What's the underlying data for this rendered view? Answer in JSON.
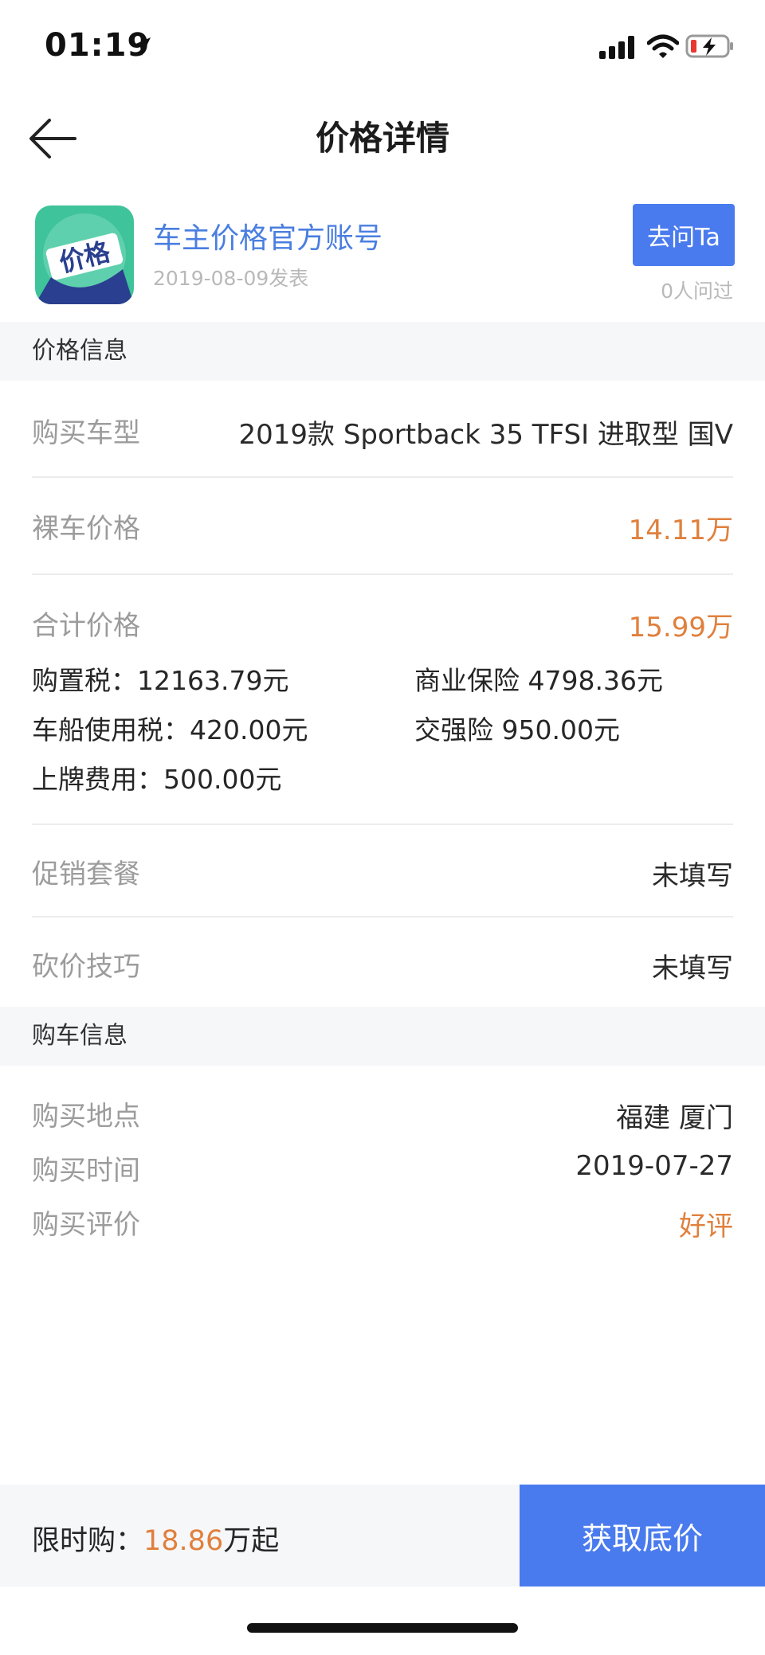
{
  "status_bar": {
    "time": "01:19"
  },
  "nav": {
    "title": "价格详情"
  },
  "author": {
    "avatar_text": "价格",
    "name": "车主价格官方账号",
    "date": "2019-08-09发表",
    "ask_label": "去问Ta",
    "ask_count": "0人问过"
  },
  "price_section": {
    "header": "价格信息",
    "model": {
      "label": "购买车型",
      "value": "2019款 Sportback 35 TFSI 进取型 国V"
    },
    "bare": {
      "label": "裸车价格",
      "value": "14.11万"
    },
    "total": {
      "label": "合计价格",
      "value": "15.99万"
    },
    "fees": {
      "purchase_tax": "购置税：12163.79元",
      "commercial_insurance": "商业保险 4798.36元",
      "vehicle_tax": "车船使用税：420.00元",
      "compulsory_insurance": "交强险 950.00元",
      "plate_fee": "上牌费用：500.00元"
    },
    "promo": {
      "label": "促销套餐",
      "value": "未填写"
    },
    "bargain": {
      "label": "砍价技巧",
      "value": "未填写"
    }
  },
  "purchase_section": {
    "header": "购车信息",
    "place": {
      "label": "购买地点",
      "value": "福建 厦门"
    },
    "time": {
      "label": "购买时间",
      "value": "2019-07-27"
    },
    "review": {
      "label": "购买评价",
      "value": "好评"
    }
  },
  "bottom_bar": {
    "limited_prefix": "限时购：",
    "limited_price": "18.86",
    "limited_suffix": "万起",
    "button_label": "获取底价"
  },
  "colors": {
    "accent_blue": "#4a7bee",
    "price_orange": "#e0803d",
    "avatar_green": "#3fc39a"
  }
}
